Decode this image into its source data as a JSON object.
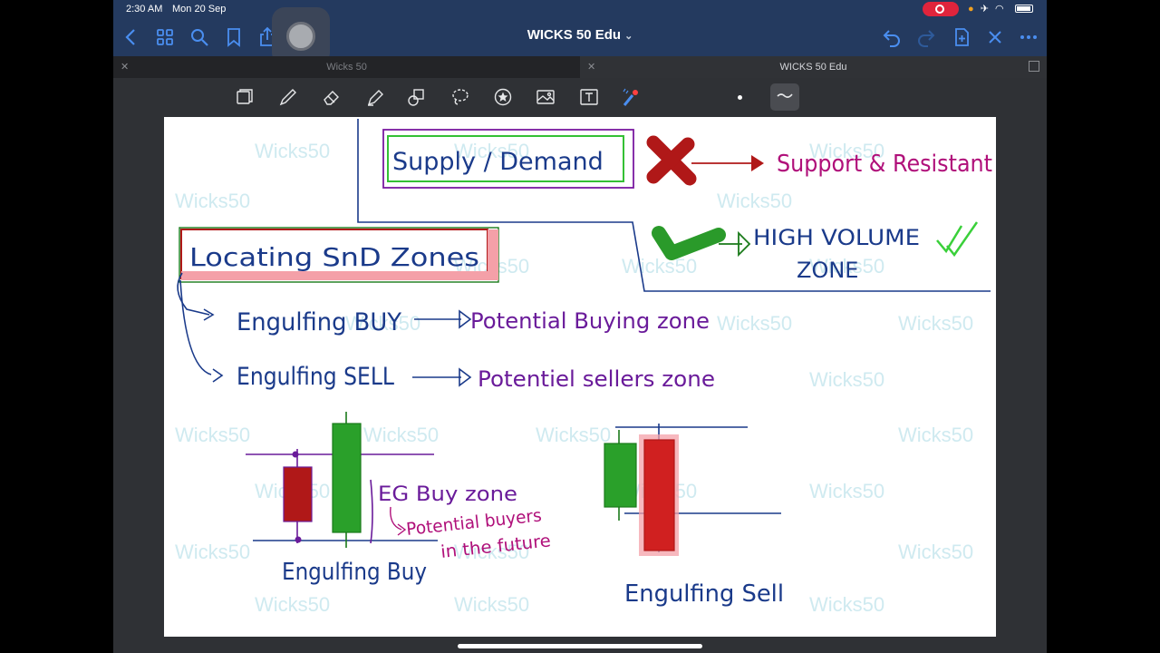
{
  "status_bar": {
    "time": "2:30 AM",
    "date": "Mon 20 Sep"
  },
  "nav": {
    "title": "WICKS 50 Edu",
    "icons": [
      "back-icon",
      "grid-icon",
      "search-icon",
      "bookmark-icon",
      "share-icon",
      "undo-icon",
      "redo-icon",
      "add-page-icon",
      "close-icon",
      "more-icon"
    ]
  },
  "tabs": [
    {
      "label": "Wicks 50",
      "active": false
    },
    {
      "label": "WICKS 50 Edu",
      "active": true
    }
  ],
  "toolbar": {
    "tools": [
      "pages-icon",
      "pen-icon",
      "eraser-icon",
      "highlighter-icon",
      "shapes-icon",
      "lasso-icon",
      "sticker-icon",
      "image-icon",
      "text-icon",
      "laser-icon"
    ]
  },
  "colors": {
    "navy": "#1a3a8a",
    "purple": "#6a1b9a",
    "magenta": "#b0107a",
    "green": "#2aa02a",
    "red": "#b01818",
    "highlight_red": "#f4a0a8",
    "accent_blue": "#4a8ef0"
  },
  "note": {
    "watermark": "Wicks50",
    "supply_demand": "Supply / Demand",
    "support_resistance": "Support & Resistant",
    "high_volume_line1": "HIGH VOLUME",
    "high_volume_line2": "ZONE",
    "locating": "Locating SnD Zones",
    "engulfing_buy": "Engulfing BUY",
    "potential_buying": "Potential Buying zone",
    "engulfing_sell": "Engulfing SELL",
    "potential_sellers": "Potentiel sellers zone",
    "eg_buy_zone": "EG Buy zone",
    "potential_buyers": "Potential buyers",
    "in_the_future": "in the future",
    "caption_buy": "Engulfing Buy",
    "caption_sell": "Engulfing Sell"
  }
}
